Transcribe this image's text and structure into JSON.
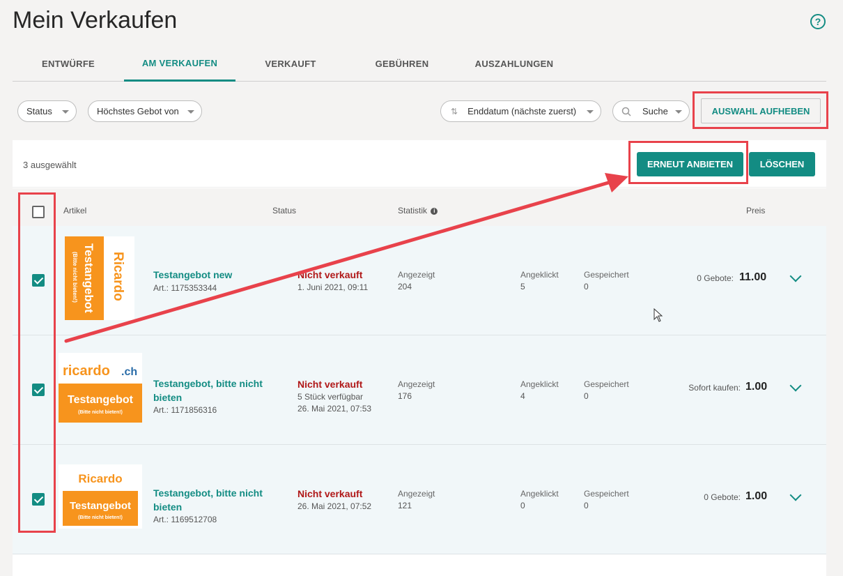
{
  "page": {
    "title": "Mein Verkaufen"
  },
  "tabs": [
    {
      "label": "ENTWÜRFE"
    },
    {
      "label": "AM VERKAUFEN"
    },
    {
      "label": "VERKAUFT"
    },
    {
      "label": "GEBÜHREN"
    },
    {
      "label": "AUSZAHLUNGEN"
    }
  ],
  "filters": {
    "status": "Status",
    "highest_bid": "Höchstes Gebot von",
    "sort": "Enddatum (nächste zuerst)",
    "search": "Suche",
    "clear_selection": "AUSWAHL AUFHEBEN"
  },
  "selection": {
    "count_text": "3 ausgewählt",
    "relist": "ERNEUT ANBIETEN",
    "delete": "LÖSCHEN"
  },
  "columns": {
    "article": "Artikel",
    "status": "Status",
    "stats": "Statistik",
    "price": "Preis"
  },
  "rows": [
    {
      "title": "Testangebot new",
      "art": "Art.: 1175353344",
      "status": "Nicht verkauft",
      "status_detail": "1. Juni 2021, 09:11",
      "shown_label": "Angezeigt",
      "shown": "204",
      "clicked_label": "Angeklickt",
      "clicked": "5",
      "saved_label": "Gespeichert",
      "saved": "0",
      "price_label": "0 Gebote:",
      "price": "11.00",
      "thumb": {
        "brand": "Ricardo",
        "text": "Testangebot",
        "sub": "(Bitte nicht bieten!)"
      }
    },
    {
      "title": "Testangebot, bitte nicht bieten",
      "art": "Art.: 1171856316",
      "status": "Nicht verkauft",
      "status_detail": "5 Stück verfügbar",
      "status_detail2": "26. Mai 2021, 07:53",
      "shown_label": "Angezeigt",
      "shown": "176",
      "clicked_label": "Angeklickt",
      "clicked": "4",
      "saved_label": "Gespeichert",
      "saved": "0",
      "price_label": "Sofort kaufen:",
      "price": "1.00",
      "thumb": {
        "brand": "ricardo",
        "brand_suffix": ".ch",
        "text": "Testangebot",
        "sub": "(Bitte nicht bieten!)"
      }
    },
    {
      "title": "Testangebot, bitte nicht bieten",
      "art": "Art.: 1169512708",
      "status": "Nicht verkauft",
      "status_detail": "26. Mai 2021, 07:52",
      "shown_label": "Angezeigt",
      "shown": "121",
      "clicked_label": "Angeklickt",
      "clicked": "0",
      "saved_label": "Gespeichert",
      "saved": "0",
      "price_label": "0 Gebote:",
      "price": "1.00",
      "thumb": {
        "brand": "Ricardo",
        "text": "Testangebot",
        "sub": "(Bitte nicht bieten!)"
      }
    }
  ],
  "colors": {
    "accent": "#138c83",
    "status_red": "#b01818",
    "annotation_red": "#e8424b",
    "thumb_orange": "#f7941d"
  }
}
